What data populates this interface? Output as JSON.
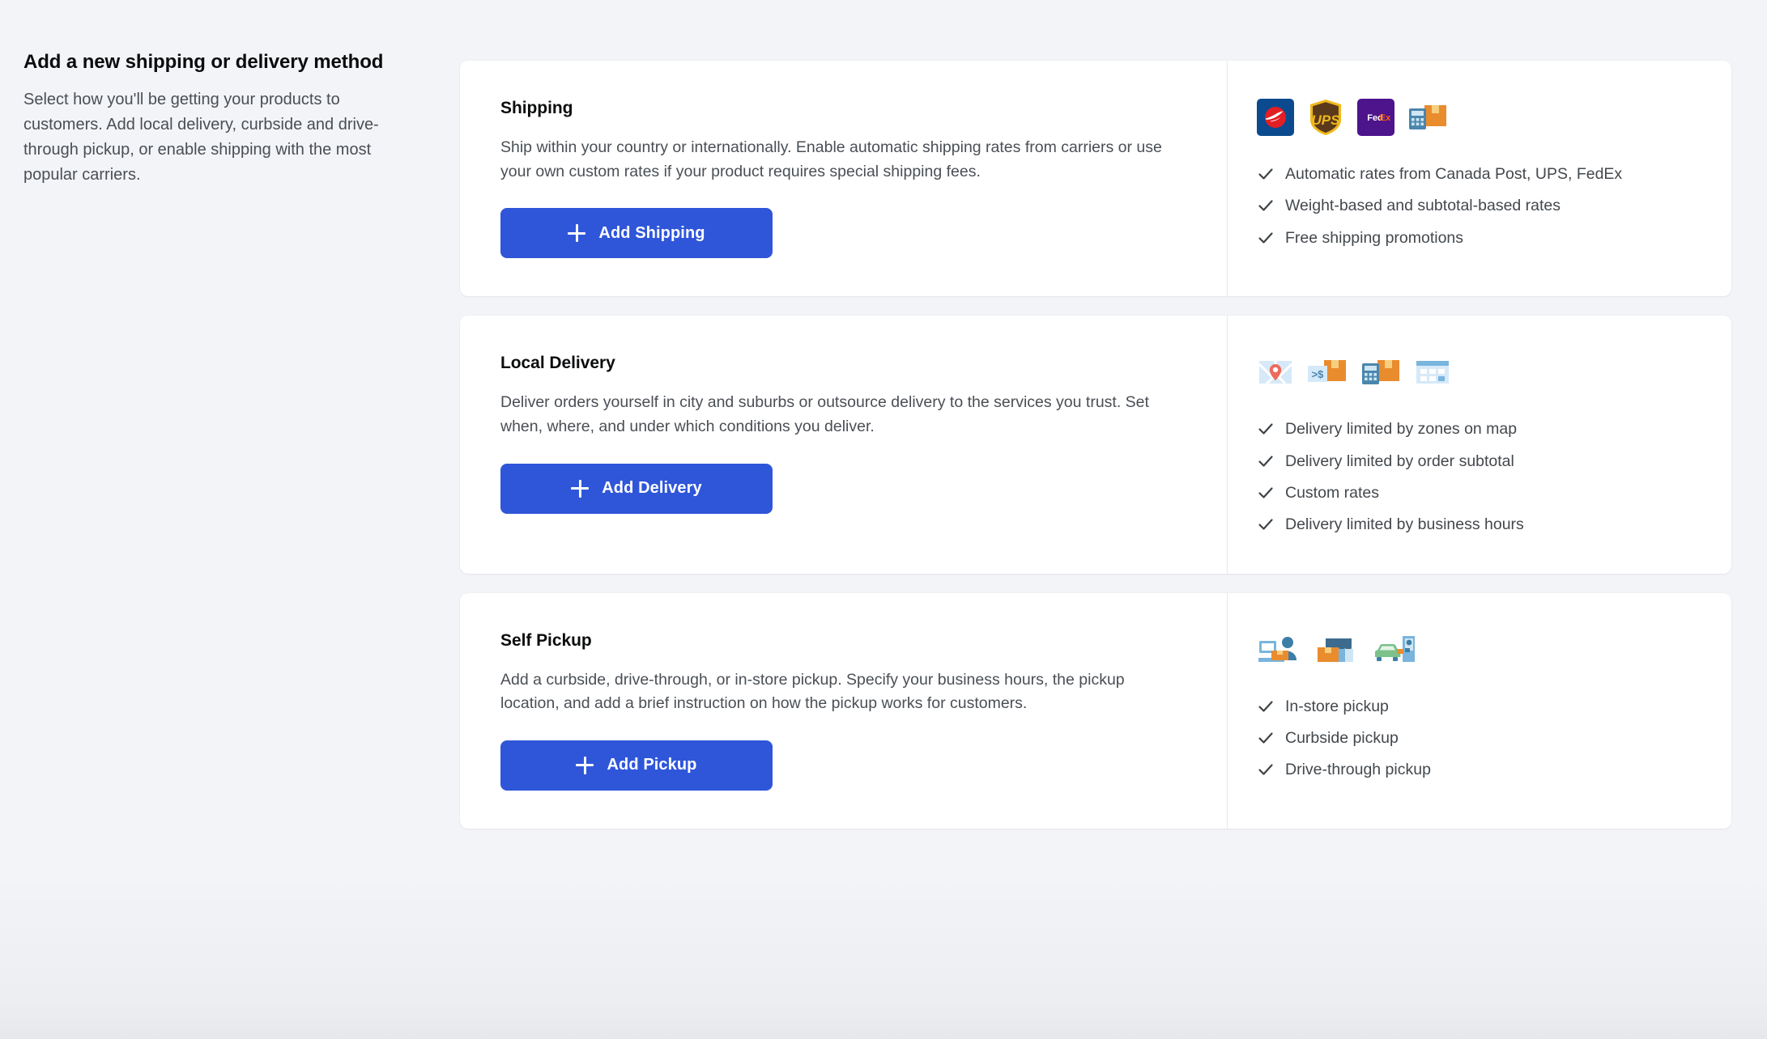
{
  "intro": {
    "title": "Add a new shipping or delivery method",
    "body": "Select how you'll be getting your products to customers. Add local delivery, curbside and drive-through pickup, or enable shipping with the most popular carriers."
  },
  "theme": {
    "accent": "#2f56d9",
    "page_bg": "#f3f4f7",
    "card_bg": "#ffffff",
    "title_color": "#0b0c0d",
    "body_color": "#4a4f55",
    "divider_color": "#e6e8ec"
  },
  "cards": [
    {
      "id": "shipping",
      "title": "Shipping",
      "description": "Ship within your country or internationally. Enable automatic shipping rates from carriers or use your own custom rates if your product requires special shipping fees.",
      "button": {
        "label": "Add Shipping",
        "icon": "plus-icon"
      },
      "icons": [
        "canada-post-icon",
        "ups-icon",
        "fedex-icon",
        "calculator-box-icon"
      ],
      "features": [
        "Automatic rates from Canada Post, UPS, FedEx",
        "Weight-based and subtotal-based rates",
        "Free shipping promotions"
      ]
    },
    {
      "id": "local-delivery",
      "title": "Local Delivery",
      "description": "Deliver orders yourself in city and suburbs or outsource delivery to the services you trust. Set when, where, and under which conditions you deliver.",
      "button": {
        "label": "Add Delivery",
        "icon": "plus-icon"
      },
      "icons": [
        "map-pin-icon",
        "subtotal-box-icon",
        "calculator-box-icon",
        "calendar-icon"
      ],
      "features": [
        "Delivery limited by zones on map",
        "Delivery limited by order subtotal",
        "Custom rates",
        "Delivery limited by business hours"
      ]
    },
    {
      "id": "self-pickup",
      "title": "Self Pickup",
      "description": "Add a curbside, drive-through, or in-store pickup. Specify your business hours, the pickup location, and add a brief instruction on how the pickup works for customers.",
      "button": {
        "label": "Add Pickup",
        "icon": "plus-icon"
      },
      "icons": [
        "counter-pickup-icon",
        "storefront-icon",
        "drive-through-icon"
      ],
      "features": [
        "In-store pickup",
        "Curbside pickup",
        "Drive-through pickup"
      ]
    }
  ]
}
